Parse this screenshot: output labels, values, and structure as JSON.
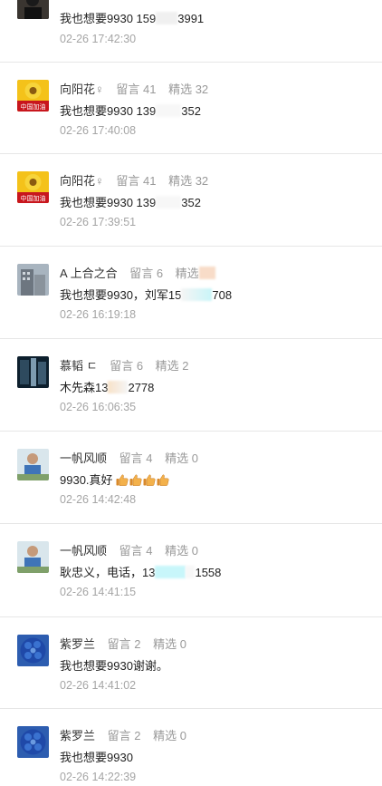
{
  "comments": [
    {
      "name": "",
      "has_head": false,
      "content": "我也想要9930  159",
      "content_tail": "3991",
      "time": "02-26 17:42:30",
      "avatar": "dark-figure"
    },
    {
      "name": "向阳花",
      "has_head": true,
      "gender": "♀",
      "liuyan": "留言 41",
      "jingxuan": "精选 32",
      "content": "我也想要9930  139",
      "content_tail": "352",
      "time": "02-26 17:40:08",
      "avatar": "sunflower",
      "avatar_caption": "中国加油"
    },
    {
      "name": "向阳花",
      "has_head": true,
      "gender": "♀",
      "liuyan": "留言 41",
      "jingxuan": "精选 32",
      "content": "我也想要9930  139",
      "content_tail": "352",
      "time": "02-26 17:39:51",
      "avatar": "sunflower",
      "avatar_caption": "中国加油"
    },
    {
      "name": "A 上合之合",
      "has_head": true,
      "liuyan": "留言 6",
      "jingxuan": "精选",
      "content": "我也想要9930，刘军15",
      "content_tail": "708",
      "time": "02-26 16:19:18",
      "avatar": "building"
    },
    {
      "name": "慕韬 ㄷ",
      "has_head": true,
      "liuyan": "留言 6",
      "jingxuan": "精选 2",
      "content": "木先森13",
      "content_tail": "2778",
      "time": "02-26 16:06:35",
      "avatar": "dark-scene"
    },
    {
      "name": "一帆风顺",
      "has_head": true,
      "liuyan": "留言 4",
      "jingxuan": "精选 0",
      "content": "9930.真好",
      "thumbs": 4,
      "time": "02-26 14:42:48",
      "avatar": "man-outdoor"
    },
    {
      "name": "一帆风顺",
      "has_head": true,
      "liuyan": "留言 4",
      "jingxuan": "精选 0",
      "content": "耿忠义，电话，13",
      "content_tail": "1558",
      "time": "02-26 14:41:15",
      "avatar": "man-outdoor"
    },
    {
      "name": "紫罗兰",
      "has_head": true,
      "liuyan": "留言 2",
      "jingxuan": "精选 0",
      "content": "我也想要9930谢谢。",
      "time": "02-26 14:41:02",
      "avatar": "blue-flower"
    },
    {
      "name": "紫罗兰",
      "has_head": true,
      "liuyan": "留言 2",
      "jingxuan": "精选 0",
      "content": "我也想要9930",
      "time": "02-26 14:22:39",
      "avatar": "blue-flower"
    }
  ],
  "colors": {
    "name": "#333333",
    "meta": "#9a9a9a",
    "time": "#a5a5a5",
    "divider": "#e6e6e6"
  }
}
